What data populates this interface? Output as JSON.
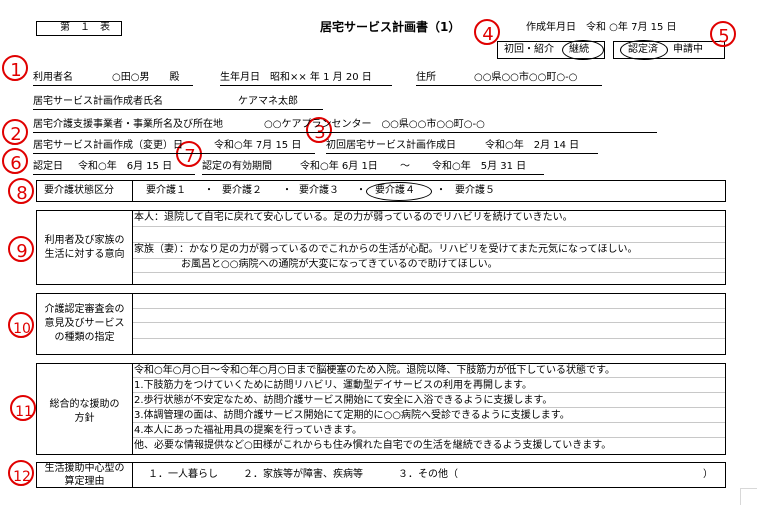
{
  "header": {
    "table_no": "第　１　表",
    "title": "居宅サービス計画書（1）",
    "created_date": "作成年月日　令和 ○年 7月 15 日",
    "status_group1_a": "初回・紹介",
    "status_group1_b": "継続",
    "status_group2_a": "認定済",
    "status_group2_b": "申請中"
  },
  "annotations": [
    "1",
    "2",
    "3",
    "4",
    "5",
    "6",
    "7",
    "8",
    "9",
    "10",
    "11",
    "12"
  ],
  "user": {
    "name_label": "利用者名",
    "name_value": "○田○男　　殿",
    "birth_label": "生年月日　昭和×× 年 1 月 20 日",
    "address_label": "住所",
    "address_value": "○○県○○市○○町○-○"
  },
  "creator": {
    "label": "居宅サービス計画作成者氏名",
    "value": "ケアマネ太郎"
  },
  "office": {
    "label": "居宅介護支援事業者・事業所名及び所在地",
    "value": "○○ケアプランセンター　○○県○○市○○町○-○"
  },
  "dates": {
    "change_label": "居宅サービス計画作成（変更）日",
    "change_value": "令和○年 7月 15 日",
    "first_label": "初回居宅サービス計画作成日",
    "first_value": "令和○年　2月 14 日",
    "cert_label": "認定日",
    "cert_value": "令和○年　6月 15 日",
    "valid_label": "認定の有効期間",
    "valid_from": "令和○年 6月 1日",
    "valid_sep": "〜",
    "valid_to": "令和○年　5月 31 日"
  },
  "care_level": {
    "label": "要介護状態区分",
    "options": [
      "要介護１",
      "要介護２",
      "要介護３",
      "要介護４",
      "要介護５"
    ],
    "separator": "・",
    "selected": "要介護４"
  },
  "intent": {
    "label_line1": "利用者及び家族の",
    "label_line2": "生活に対する意向",
    "line1": "本人：退院して自宅に戻れて安心している。足の力が弱っているのでリハビリを続けていきたい。",
    "line2": "家族（妻）：かなり足の力が弱っているのでこれからの生活が心配。リハビリを受けてまた元気になってほしい。",
    "line3": "お風呂と○○病院への通院が大変になってきているので助けてほしい。"
  },
  "opinion": {
    "label_line1": "介護認定審査会の",
    "label_line2": "意見及びサービス",
    "label_line3": "の種類の指定"
  },
  "policy": {
    "label_line1": "総合的な援助の",
    "label_line2": "方針",
    "lines": [
      "令和○年○月○日〜令和○年○月○日まで脳梗塞のため入院。退院以降、下肢筋力が低下している状態です。",
      "1.下肢筋力をつけていくために訪問リハビリ、運動型デイサービスの利用を再開します。",
      "2.歩行状態が不安定なため、訪問介護サービス開始にて安全に入浴できるように支援します。",
      "3.体調管理の面は、訪問介護サービス開始にて定期的に○○病院へ受診できるように支援します。",
      "4.本人にあった福祉用具の提案を行っていきます。",
      "他、必要な情報提供など○田様がこれからも住み慣れた自宅での生活を継続できるよう支援していきます。"
    ]
  },
  "reason": {
    "label_line1": "生活援助中心型の",
    "label_line2": "算定理由",
    "opt1": "１．一人暮らし",
    "opt2": "２．家族等が障害、疾病等",
    "opt3": "３．その他（",
    "opt3_close": "）"
  }
}
